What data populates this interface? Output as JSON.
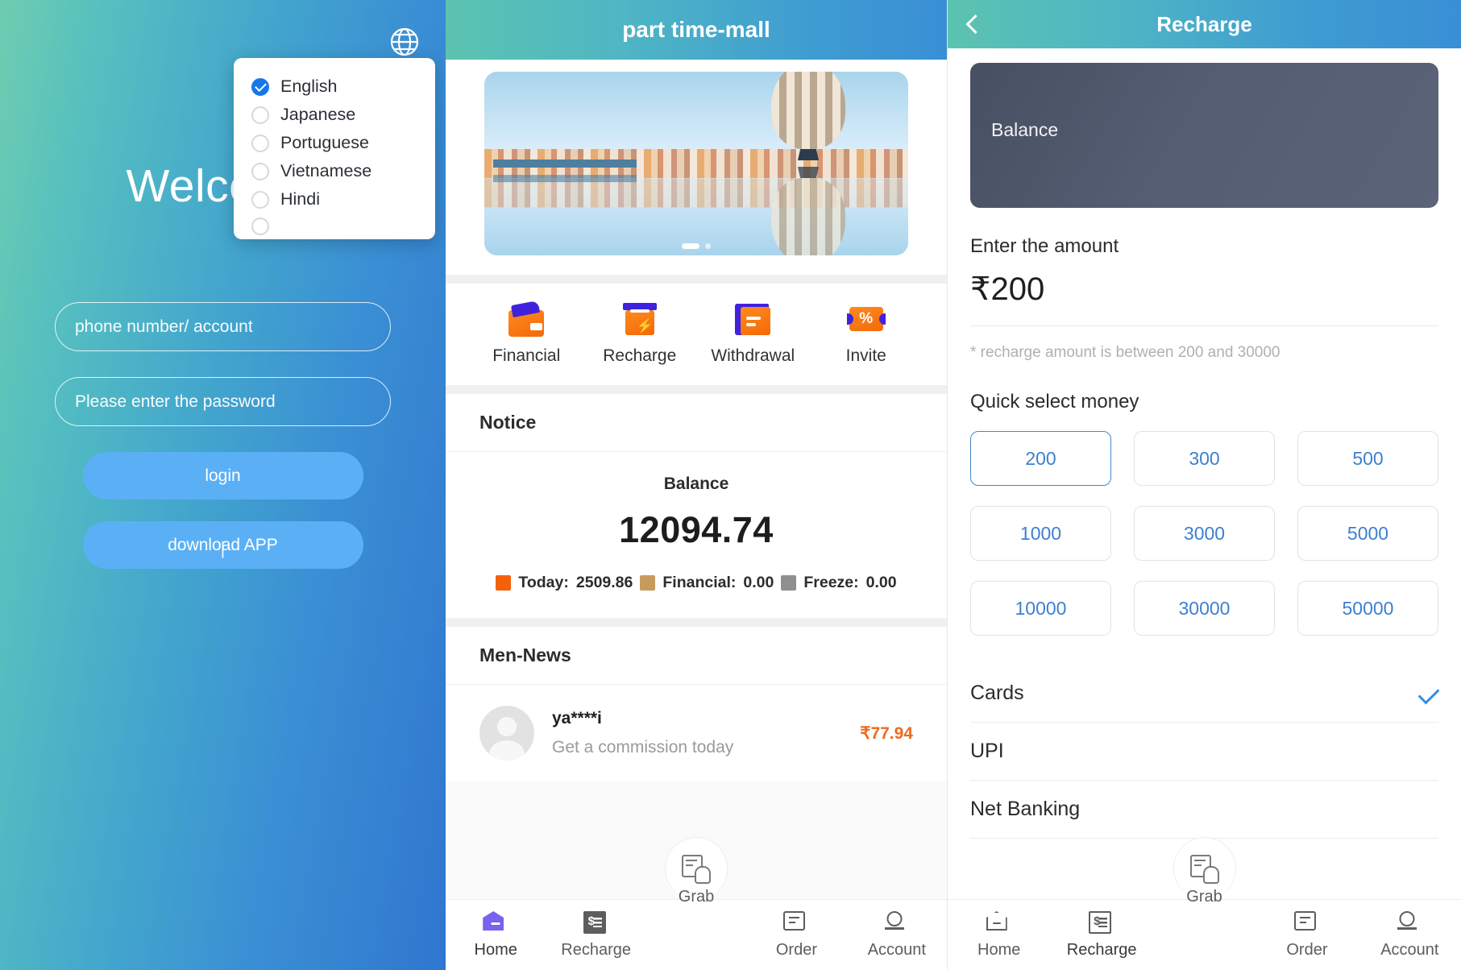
{
  "login": {
    "globe_icon": "globe-icon",
    "welcome": "Welcome",
    "language_dropdown": {
      "items": [
        {
          "label": "English",
          "selected": true
        },
        {
          "label": "Japanese",
          "selected": false
        },
        {
          "label": "Portuguese",
          "selected": false
        },
        {
          "label": "Vietnamese",
          "selected": false
        },
        {
          "label": "Hindi",
          "selected": false
        }
      ]
    },
    "account_placeholder": "phone number/ account",
    "password_placeholder": "Please enter the password",
    "login_button": "login",
    "download_button": "download APP",
    "caret": "|"
  },
  "mall": {
    "header_title": "part time-mall",
    "quick_icons": [
      {
        "label": "Financial",
        "icon": "wallet-icon"
      },
      {
        "label": "Recharge",
        "icon": "atm-card-icon"
      },
      {
        "label": "Withdrawal",
        "icon": "withdraw-icon"
      },
      {
        "label": "Invite",
        "icon": "percent-ticket-icon"
      }
    ],
    "notice_title": "Notice",
    "balance": {
      "label": "Balance",
      "value": "12094.74",
      "breakdown": [
        {
          "label": "Today:",
          "value": "2509.86",
          "color": "#f4610d"
        },
        {
          "label": "Financial:",
          "value": "0.00",
          "color": "#c79a5e"
        },
        {
          "label": "Freeze:",
          "value": "0.00",
          "color": "#8f8f8f"
        }
      ]
    },
    "news_title": "Men-News",
    "news_items": [
      {
        "name": "ya****i",
        "text": "Get a commission today",
        "amount": "₹77.94"
      }
    ],
    "tabs": [
      {
        "label": "Home",
        "icon": "home-icon",
        "active": true
      },
      {
        "label": "Recharge",
        "icon": "receipt-dollar-icon",
        "active": false
      },
      {
        "label": "Grab",
        "icon": "grab-hand-icon",
        "active": false
      },
      {
        "label": "Order",
        "icon": "order-icon",
        "active": false
      },
      {
        "label": "Account",
        "icon": "account-icon",
        "active": false
      }
    ]
  },
  "recharge": {
    "header_title": "Recharge",
    "back_icon": "back-chevron-icon",
    "balance_card_label": "Balance",
    "enter_amount_label": "Enter the amount",
    "amount_value": "₹200",
    "hint": "* recharge amount is between 200 and 30000",
    "quick_select_label": "Quick select money",
    "quick_amounts": [
      {
        "value": "200",
        "selected": true
      },
      {
        "value": "300",
        "selected": false
      },
      {
        "value": "500",
        "selected": false
      },
      {
        "value": "1000",
        "selected": false
      },
      {
        "value": "3000",
        "selected": false
      },
      {
        "value": "5000",
        "selected": false
      },
      {
        "value": "10000",
        "selected": false
      },
      {
        "value": "30000",
        "selected": false
      },
      {
        "value": "50000",
        "selected": false
      }
    ],
    "payment_methods": [
      {
        "label": "Cards",
        "selected": true
      },
      {
        "label": "UPI",
        "selected": false
      },
      {
        "label": "Net Banking",
        "selected": false
      }
    ],
    "tabs": [
      {
        "label": "Home",
        "icon": "home-icon",
        "active": false
      },
      {
        "label": "Recharge",
        "icon": "receipt-dollar-icon",
        "active": true
      },
      {
        "label": "Grab",
        "icon": "grab-hand-icon",
        "active": false
      },
      {
        "label": "Order",
        "icon": "order-icon",
        "active": false
      },
      {
        "label": "Account",
        "icon": "account-icon",
        "active": false
      }
    ]
  },
  "colors": {
    "accent_blue": "#3d7fd0",
    "header_gradient_start": "#5cc3b0",
    "header_gradient_end": "#3a8fd4",
    "orange": "#f4610d",
    "purple": "#7b61f0"
  }
}
